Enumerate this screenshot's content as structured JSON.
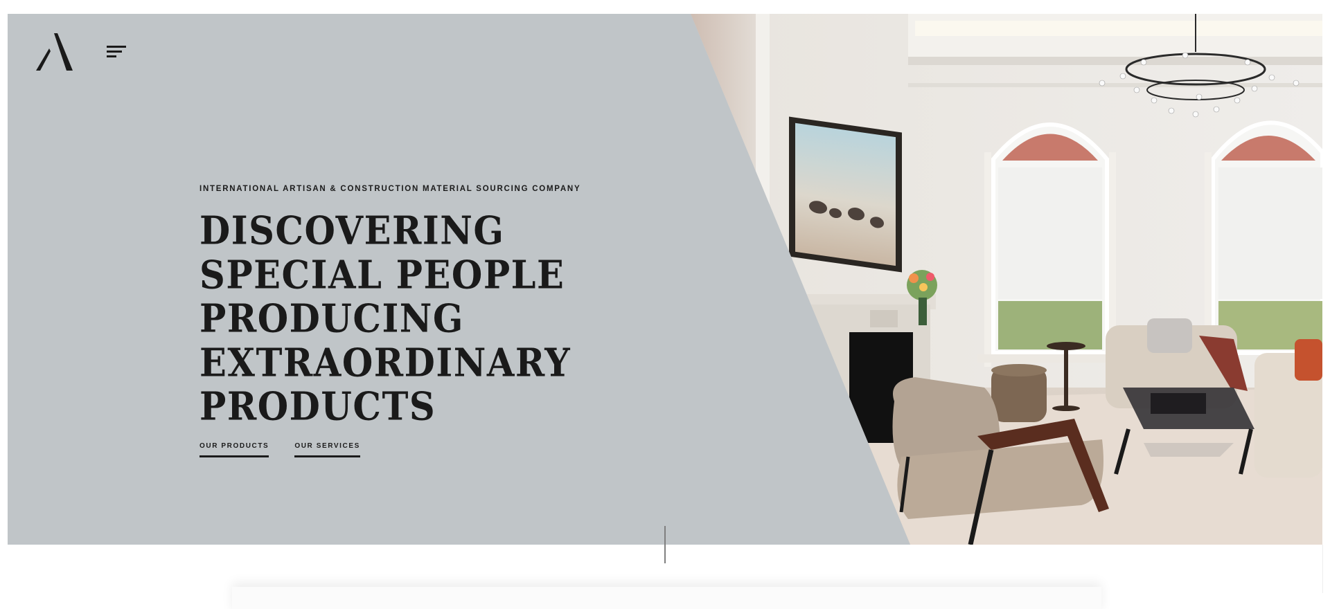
{
  "brand": {
    "logo_icon": "a-monogram-icon",
    "logo_color": "#1a1a1a"
  },
  "nav": {
    "menu_icon": "hamburger-menu-icon"
  },
  "hero": {
    "eyebrow": "INTERNATIONAL ARTISAN & CONSTRUCTION MATERIAL SOURCING COMPANY",
    "headline_lines": [
      "DISCOVERING",
      "SPECIAL PEOPLE",
      "PRODUCING",
      "EXTRAORDINARY",
      "PRODUCTS"
    ],
    "links": [
      {
        "label": "OUR PRODUCTS"
      },
      {
        "label": "OUR SERVICES"
      }
    ],
    "panel_color": "#c0c5c8",
    "text_color": "#1a1a1a",
    "photo_subject": "living-room-interior-photo"
  },
  "scroll": {
    "icon": "scroll-indicator-line"
  }
}
